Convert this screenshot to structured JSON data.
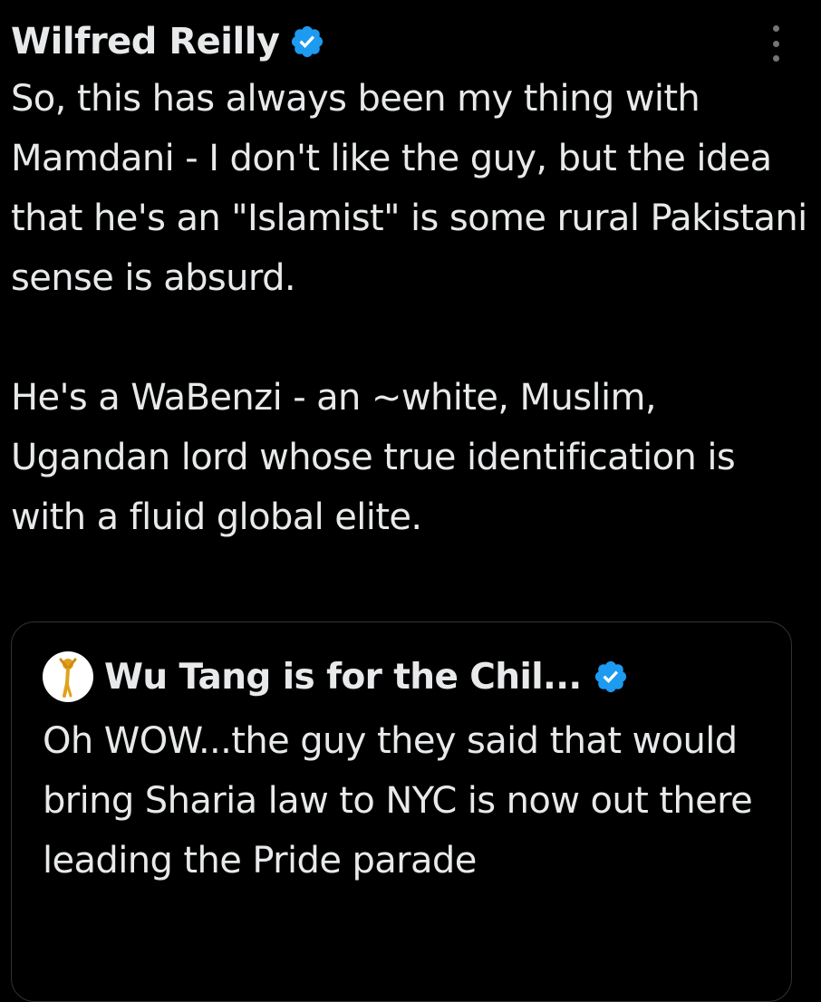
{
  "tweet": {
    "author_name": "Wilfred Reilly",
    "text": "So, this has always been my thing with Mamdani - I don't like the guy, but the idea that he's an \"Islamist\" is some rural Pakistani sense is absurd.\n\nHe's a WaBenzi - an ~white, Muslim, Ugandan lord whose true identification is with a fluid global elite.",
    "verified_badge_color": "#1d9bf0"
  },
  "quoted_tweet": {
    "author_name": "Wu Tang is for the Chil...",
    "text": "Oh WOW...the guy they said that would bring Sharia law to NYC is now out there leading the Pride parade",
    "avatar_icon": "golden-figure-avatar",
    "verified_badge_color": "#1d9bf0"
  },
  "colors": {
    "background": "#000000",
    "text": "#e7e9ea",
    "border": "#2f3336",
    "muted": "#71767b"
  }
}
